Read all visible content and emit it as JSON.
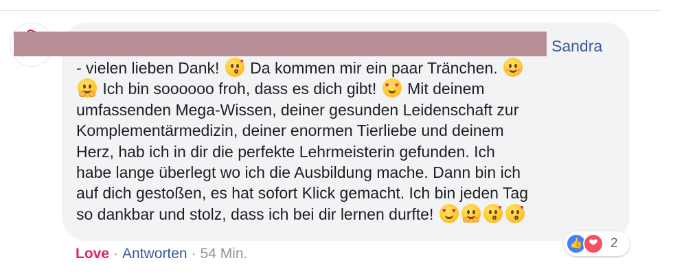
{
  "comment": {
    "author": "Sandra",
    "lines": [
      [
        "- vielen lieben Dank! ",
        {
          "emoji": "kissing-heart-face"
        },
        " Da kommen mir ein paar Tränchen. ",
        {
          "emoji": "smiling-face"
        }
      ],
      [
        {
          "emoji": "hugging-face"
        },
        " Ich bin soooooo froh, dass es dich gibt! ",
        {
          "emoji": "heart-eyes-face"
        },
        " Mit deinem"
      ],
      [
        "umfassenden Mega-Wissen, deiner gesunden Leidenschaft zur"
      ],
      [
        "Komplementärmedizin, deiner enormen Tierliebe und deinem"
      ],
      [
        "Herz, hab ich in dir die perfekte Lehrmeisterin gefunden. Ich"
      ],
      [
        "habe lange überlegt wo ich die Ausbildung mache. Dann bin ich"
      ],
      [
        "auf dich gestoßen, es hat sofort Klick gemacht. Ich bin jeden Tag"
      ],
      [
        "so dankbar und stolz, dass ich bei dir lernen durfte! ",
        {
          "emoji": "heart-eyes-face"
        },
        {
          "emoji": "hugging-face"
        },
        {
          "emoji": "kissing-heart-face"
        },
        {
          "emoji": "kissing-heart-face"
        }
      ]
    ]
  },
  "actions": {
    "love_label": "Love",
    "separator": "·",
    "reply_label": "Antworten",
    "timestamp": "54 Min."
  },
  "reactions": {
    "icons": [
      "like-icon",
      "love-icon"
    ],
    "count": "2"
  },
  "colors": {
    "bubble": "#f2f3f5",
    "link": "#385898",
    "love": "#e0245e",
    "redaction": "#b88e96"
  }
}
